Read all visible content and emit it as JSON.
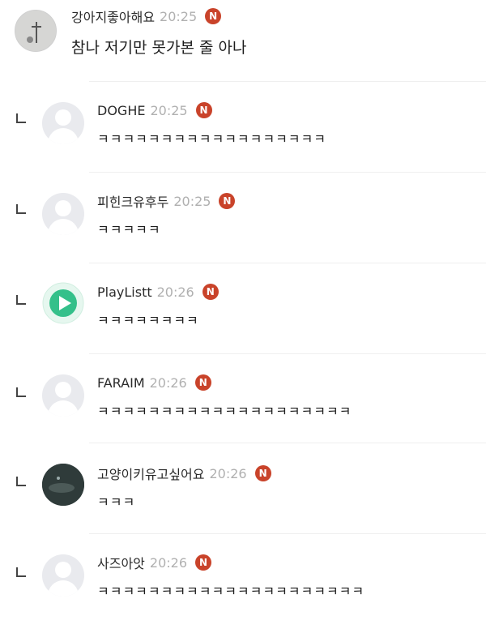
{
  "badge_label": "N",
  "comments": [
    {
      "author": "강아지좋아해요",
      "time": "20:25",
      "text": "참나 저기만 못가본 줄 아나",
      "avatar": "photo-avatar",
      "reply": false
    },
    {
      "author": "DOGHE",
      "time": "20:25",
      "text": "ㅋㅋㅋㅋㅋㅋㅋㅋㅋㅋㅋㅋㅋㅋㅋㅋㅋㅋ",
      "avatar": "default-user-icon",
      "reply": true
    },
    {
      "author": "피힌크유후두",
      "time": "20:25",
      "text": "ㅋㅋㅋㅋㅋ",
      "avatar": "default-user-icon",
      "reply": true
    },
    {
      "author": "PlayListt",
      "time": "20:26",
      "text": "ㅋㅋㅋㅋㅋㅋㅋㅋ",
      "avatar": "play-icon",
      "reply": true
    },
    {
      "author": "FARAIM",
      "time": "20:26",
      "text": "ㅋㅋㅋㅋㅋㅋㅋㅋㅋㅋㅋㅋㅋㅋㅋㅋㅋㅋㅋㅋ",
      "avatar": "default-user-icon",
      "reply": true
    },
    {
      "author": "고양이키유고싶어요",
      "time": "20:26",
      "text": "ㅋㅋㅋ",
      "avatar": "photo-avatar",
      "reply": true
    },
    {
      "author": "사즈아앗",
      "time": "20:26",
      "text": "ㅋㅋㅋㅋㅋㅋㅋㅋㅋㅋㅋㅋㅋㅋㅋㅋㅋㅋㅋㅋㅋ",
      "avatar": "default-user-icon",
      "reply": true
    }
  ],
  "colors": {
    "badge": "#c9432a",
    "time": "#b0b0b0",
    "play_accent": "#34c08a"
  }
}
